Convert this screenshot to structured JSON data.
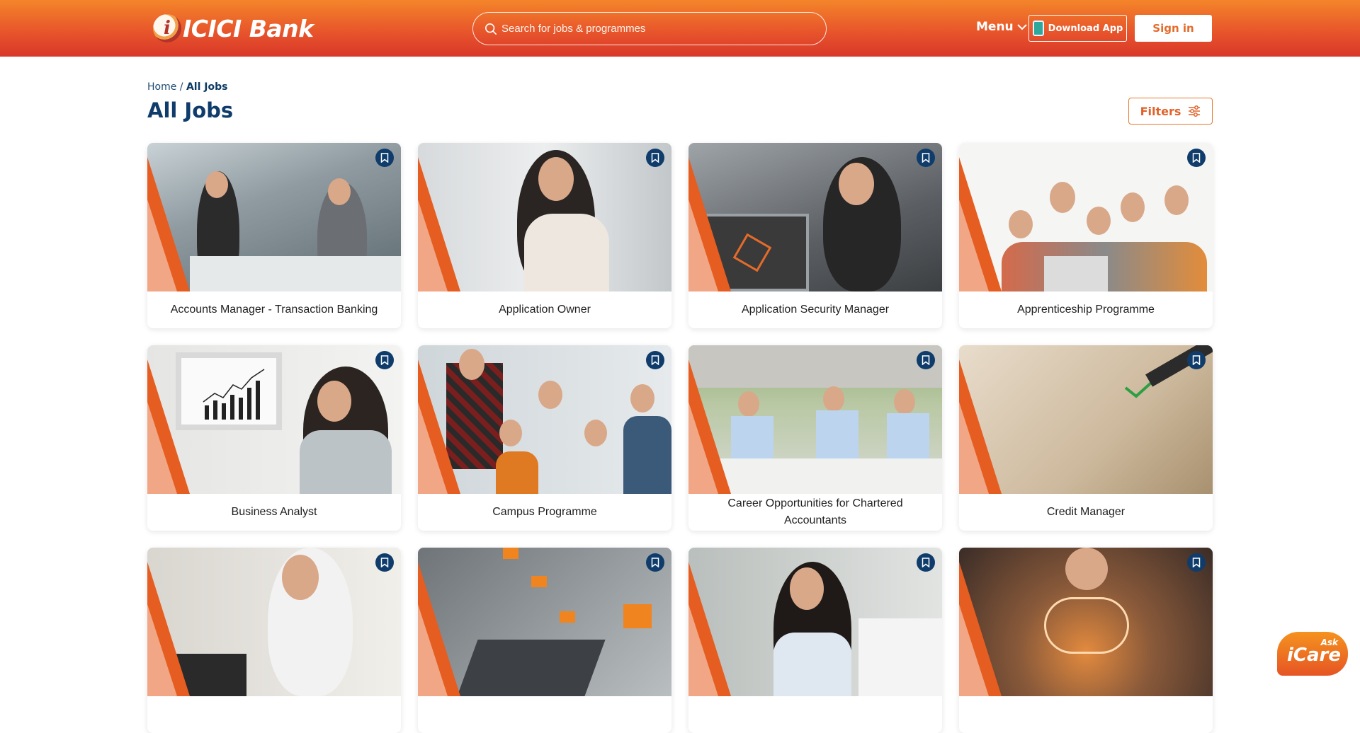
{
  "header": {
    "logo_mark": "i",
    "logo_text": "ICICI Bank",
    "search_placeholder": "Search for jobs & programmes",
    "menu_label": "Menu",
    "download_label": "Download App",
    "signin_label": "Sign in"
  },
  "breadcrumb": {
    "home": "Home",
    "separator": "/",
    "current": "All Jobs"
  },
  "page": {
    "title": "All Jobs",
    "filters_label": "Filters"
  },
  "jobs": [
    {
      "title": "Accounts Manager - Transaction Banking"
    },
    {
      "title": "Application Owner"
    },
    {
      "title": "Application Security Manager"
    },
    {
      "title": "Apprenticeship Programme"
    },
    {
      "title": "Business Analyst"
    },
    {
      "title": "Campus Programme"
    },
    {
      "title": "Career Opportunities for Chartered Accountants"
    },
    {
      "title": "Credit Manager"
    },
    {
      "title": ""
    },
    {
      "title": ""
    },
    {
      "title": ""
    },
    {
      "title": ""
    }
  ],
  "icare": {
    "ask": "Ask",
    "care": "iCare"
  },
  "colors": {
    "header_top": "#f4852a",
    "header_bottom": "#d9372a",
    "navy": "#0f3c6b",
    "accent": "#e55d21"
  }
}
